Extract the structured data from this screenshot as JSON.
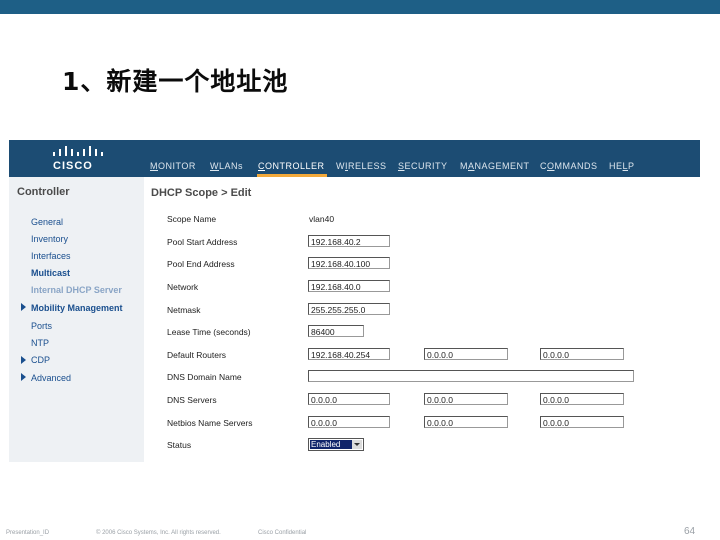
{
  "slide": {
    "title": "1、新建一个地址池",
    "footer_left": "Presentation_ID",
    "footer_copyright": "© 2006 Cisco Systems, Inc. All rights reserved.",
    "footer_confidential": "Cisco Confidential",
    "page_number": "64",
    "colors": {
      "top_bar": "#1e5f86",
      "nav_bar": "#1c4c73",
      "active_underline": "#f2a93b",
      "link": "#1a4f8e"
    }
  },
  "app": {
    "logo_text": "CISCO",
    "menu": [
      {
        "pre": "",
        "u": "M",
        "post": "ONITOR"
      },
      {
        "pre": "",
        "u": "W",
        "post": "LANs"
      },
      {
        "pre": "",
        "u": "C",
        "post": "ONTROLLER"
      },
      {
        "pre": "W",
        "u": "I",
        "post": "RELESS"
      },
      {
        "pre": "",
        "u": "S",
        "post": "ECURITY"
      },
      {
        "pre": "M",
        "u": "A",
        "post": "NAGEMENT"
      },
      {
        "pre": "C",
        "u": "O",
        "post": "MMANDS"
      },
      {
        "pre": "HE",
        "u": "L",
        "post": "P"
      }
    ],
    "active_menu": "CONTROLLER"
  },
  "sidebar": {
    "heading": "Controller",
    "items": [
      {
        "label": "General"
      },
      {
        "label": "Inventory"
      },
      {
        "label": "Interfaces"
      },
      {
        "label": "Multicast"
      },
      {
        "label": "Internal DHCP Server"
      },
      {
        "label": "Mobility Management"
      },
      {
        "label": "Ports"
      },
      {
        "label": "NTP"
      },
      {
        "label": "CDP"
      },
      {
        "label": "Advanced"
      }
    ]
  },
  "form": {
    "heading": "DHCP Scope > Edit",
    "scope_name_label": "Scope Name",
    "scope_name_value": "vlan40",
    "pool_start_label": "Pool Start Address",
    "pool_start_value": "192.168.40.2",
    "pool_end_label": "Pool End Address",
    "pool_end_value": "192.168.40.100",
    "network_label": "Network",
    "network_value": "192.168.40.0",
    "netmask_label": "Netmask",
    "netmask_value": "255.255.255.0",
    "lease_label": "Lease Time (seconds)",
    "lease_value": "86400",
    "default_routers_label": "Default Routers",
    "default_routers": [
      "192.168.40.254",
      "0.0.0.0",
      "0.0.0.0"
    ],
    "dns_domain_label": "DNS Domain Name",
    "dns_domain_value": "",
    "dns_servers_label": "DNS Servers",
    "dns_servers": [
      "0.0.0.0",
      "0.0.0.0",
      "0.0.0.0"
    ],
    "netbios_label": "Netbios Name Servers",
    "netbios_servers": [
      "0.0.0.0",
      "0.0.0.0",
      "0.0.0.0"
    ],
    "status_label": "Status",
    "status_value": "Enabled"
  }
}
